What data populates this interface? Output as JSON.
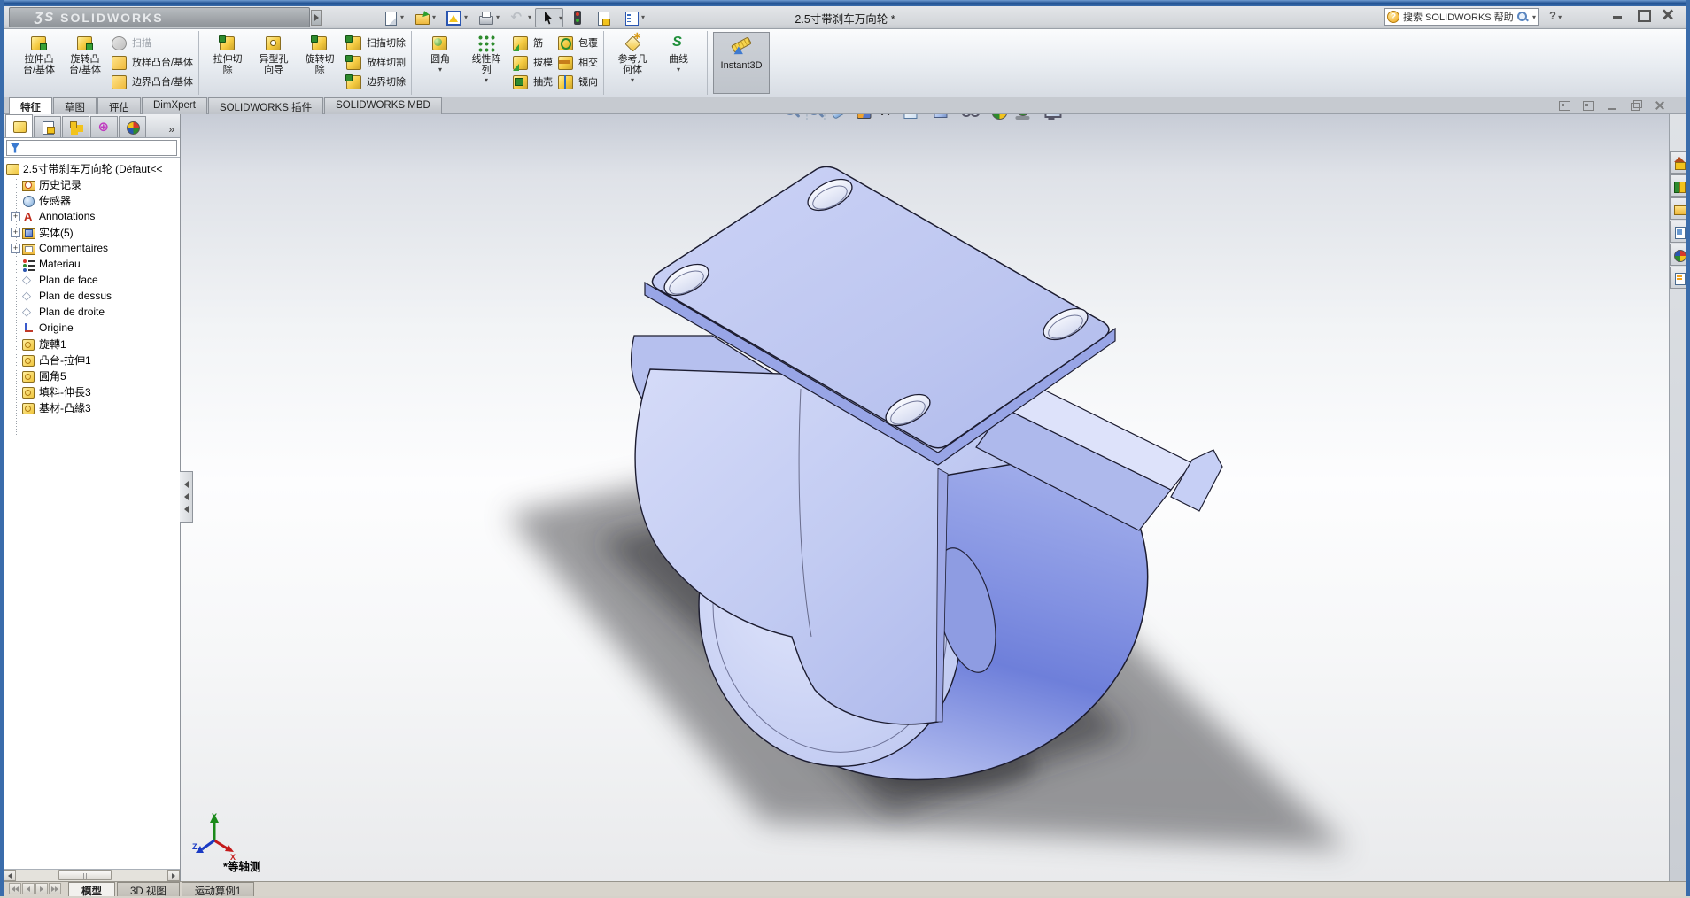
{
  "titlebar": {
    "logo_prefix": "ƷS",
    "logo_text": "SOLIDWORKS",
    "title": "2.5寸带刹车万向轮 *",
    "search_placeholder": "搜索 SOLIDWORKS 帮助",
    "help_label": "?"
  },
  "quick_toolbar": [
    {
      "icon": "new-document-icon",
      "caret": true
    },
    {
      "icon": "open-icon",
      "caret": true
    },
    {
      "icon": "make-drawing-icon",
      "caret": true
    },
    {
      "icon": "print-icon",
      "caret": true
    },
    {
      "icon": "undo-icon",
      "caret": true,
      "disabled": true
    },
    {
      "icon": "select-cursor-icon",
      "caret": true,
      "pressed": true
    },
    {
      "icon": "rebuild-icon"
    },
    {
      "icon": "file-properties-icon"
    },
    {
      "icon": "options-icon",
      "caret": true
    }
  ],
  "ribbon": {
    "group1_big": [
      {
        "icon": "extrude-boss-icon",
        "label": "拉伸凸\n台/基体"
      },
      {
        "icon": "revolve-boss-icon",
        "label": "旋转凸\n台/基体"
      }
    ],
    "group1_small": [
      {
        "icon": "sweep-icon",
        "label": "扫描",
        "disabled": true
      },
      {
        "icon": "loft-boss-icon",
        "label": "放样凸台/基体"
      },
      {
        "icon": "boundary-boss-icon",
        "label": "边界凸台/基体"
      }
    ],
    "group2_big": [
      {
        "icon": "extrude-cut-icon",
        "label": "拉伸切\n除"
      },
      {
        "icon": "hole-wizard-icon",
        "label": "异型孔\n向导"
      },
      {
        "icon": "revolve-cut-icon",
        "label": "旋转切\n除"
      }
    ],
    "group2_small": [
      {
        "icon": "sweep-cut-icon",
        "label": "扫描切除"
      },
      {
        "icon": "loft-cut-icon",
        "label": "放样切割"
      },
      {
        "icon": "boundary-cut-icon",
        "label": "边界切除"
      }
    ],
    "group3_big": [
      {
        "icon": "fillet-icon",
        "label": "圆角",
        "caret": true
      },
      {
        "icon": "linear-pattern-icon",
        "label": "线性阵\n列",
        "caret": true
      }
    ],
    "group3_small": [
      {
        "icon": "rib-icon",
        "label": "筋"
      },
      {
        "icon": "draft-icon",
        "label": "拔模"
      },
      {
        "icon": "shell-icon",
        "label": "抽壳"
      },
      {
        "icon": "wrap-icon",
        "label": "包覆"
      },
      {
        "icon": "intersect-icon",
        "label": "相交"
      },
      {
        "icon": "mirror-icon",
        "label": "镜向"
      }
    ],
    "group4_big": [
      {
        "icon": "reference-geometry-icon",
        "label": "参考几\n何体",
        "caret": true
      },
      {
        "icon": "curves-icon",
        "label": "曲线",
        "caret": true
      }
    ],
    "group5_big": [
      {
        "icon": "instant3d-icon",
        "label": "Instant3D",
        "pressed": true
      }
    ]
  },
  "command_tabs": [
    {
      "label": "特征",
      "active": true
    },
    {
      "label": "草图"
    },
    {
      "label": "评估"
    },
    {
      "label": "DimXpert"
    },
    {
      "label": "SOLIDWORKS 插件"
    },
    {
      "label": "SOLIDWORKS MBD"
    }
  ],
  "headsup": [
    {
      "icon": "zoom-fit-icon"
    },
    {
      "icon": "zoom-area-icon"
    },
    {
      "icon": "previous-view-icon"
    },
    {
      "icon": "section-view-icon"
    },
    {
      "icon": "3d-drawing-view-icon"
    },
    {
      "icon": "view-orientation-icon",
      "caret": true
    },
    {
      "icon": "display-style-icon",
      "caret": true
    },
    {
      "icon": "hide-show-items-icon",
      "caret": true
    },
    {
      "icon": "edit-appearance-icon"
    },
    {
      "icon": "apply-scene-icon",
      "caret": true
    },
    {
      "icon": "view-settings-icon",
      "caret": true
    }
  ],
  "feature_panel": {
    "tabs": [
      {
        "icon": "featuremanager-tree-icon",
        "active": true
      },
      {
        "icon": "property-manager-icon"
      },
      {
        "icon": "configuration-manager-icon"
      },
      {
        "icon": "dimxpert-manager-icon"
      },
      {
        "icon": "display-manager-icon"
      }
    ],
    "overflow": "»",
    "items": [
      {
        "icon": "part-icon",
        "label": "2.5寸带刹车万向轮 (Défaut<<",
        "indent": 0
      },
      {
        "icon": "history-icon",
        "label": "历史记录",
        "indent": 1
      },
      {
        "icon": "sensors-icon",
        "label": "传感器",
        "indent": 1
      },
      {
        "icon": "annotations-icon",
        "label": "Annotations",
        "indent": 1,
        "expand": "plus"
      },
      {
        "icon": "solid-bodies-icon",
        "label": "实体(5)",
        "indent": 1,
        "expand": "plus"
      },
      {
        "icon": "comments-icon",
        "label": "Commentaires",
        "indent": 1,
        "expand": "plus"
      },
      {
        "icon": "material-icon",
        "label": "Materiau",
        "indent": 1
      },
      {
        "icon": "plane-icon",
        "label": "Plan de face",
        "indent": 1
      },
      {
        "icon": "plane-icon",
        "label": "Plan de dessus",
        "indent": 1
      },
      {
        "icon": "plane-icon",
        "label": "Plan de droite",
        "indent": 1
      },
      {
        "icon": "origin-icon",
        "label": "Origine",
        "indent": 1
      },
      {
        "icon": "feature-icon",
        "label": "旋轉1",
        "indent": 1
      },
      {
        "icon": "feature-icon",
        "label": "凸台-拉伸1",
        "indent": 1
      },
      {
        "icon": "feature-icon",
        "label": "圓角5",
        "indent": 1
      },
      {
        "icon": "feature-icon",
        "label": "填料-伸長3",
        "indent": 1
      },
      {
        "icon": "feature-icon",
        "label": "基材-凸緣3",
        "indent": 1
      }
    ]
  },
  "taskpane": [
    {
      "icon": "home-icon"
    },
    {
      "icon": "design-library-icon"
    },
    {
      "icon": "file-explorer-icon"
    },
    {
      "icon": "view-palette-icon"
    },
    {
      "icon": "appearances-icon"
    },
    {
      "icon": "custom-properties-icon"
    }
  ],
  "viewport": {
    "view_label": "*等轴测",
    "triad": {
      "x": "X",
      "y": "Y",
      "z": "Z"
    }
  },
  "bottom_bar": {
    "tabs": [
      {
        "label": "模型",
        "active": true
      },
      {
        "label": "3D 视图"
      },
      {
        "label": "运动算例1"
      }
    ]
  },
  "colors": {
    "model_fill": "#bdc6f0",
    "model_edge": "#1c1c30",
    "titlebar_blue": "#1d4e8f",
    "window_border": "#3a6cab"
  }
}
